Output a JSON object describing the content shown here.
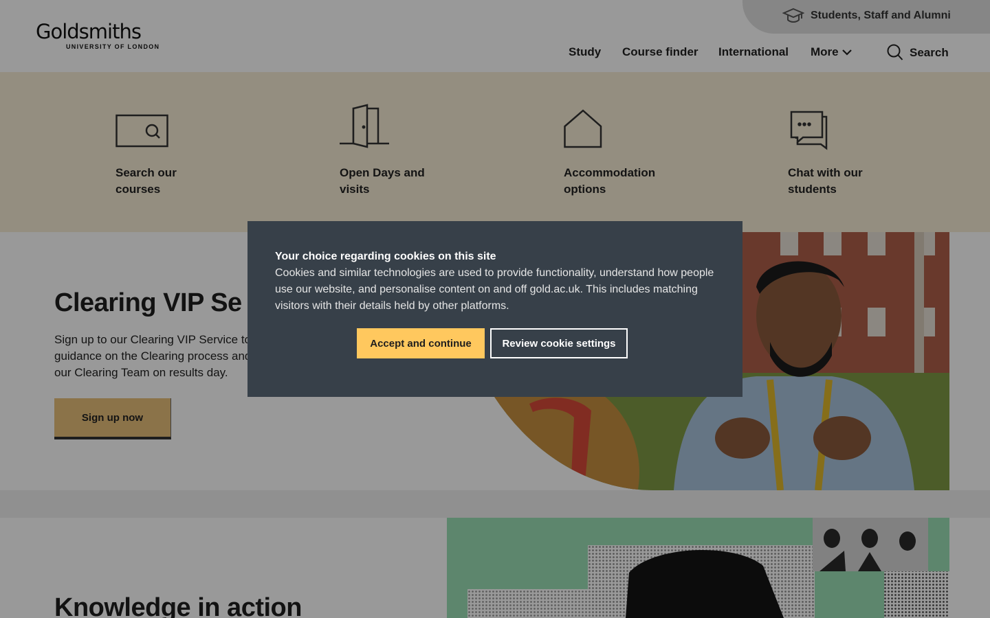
{
  "header": {
    "logo_wordmark": "Goldsmiths",
    "logo_sub": "UNIVERSITY OF LONDON",
    "audience_link": {
      "label": "Students, Staff and Alumni",
      "icon": "mortarboard-icon"
    },
    "nav": [
      {
        "label": "Study"
      },
      {
        "label": "Course finder"
      },
      {
        "label": "International"
      },
      {
        "label": "More",
        "icon": "chevron-down-icon"
      },
      {
        "label": "Search",
        "icon": "search-icon"
      }
    ]
  },
  "quick_links": [
    {
      "label": "Search our courses",
      "icon": "course-search-icon"
    },
    {
      "label": "Open Days and visits",
      "icon": "open-door-icon"
    },
    {
      "label": "Accommodation options",
      "icon": "house-icon"
    },
    {
      "label": "Chat with our students",
      "icon": "chat-bubbles-icon"
    }
  ],
  "clearing": {
    "title": "Clearing VIP Se",
    "text": "Sign up to our Clearing VIP Service to guidance on the Clearing process and our Clearing Team on results day.",
    "button": "Sign up now"
  },
  "knowledge": {
    "title": "Knowledge in action"
  },
  "cookie_banner": {
    "title": "Your choice regarding cookies on this site",
    "body": "Cookies and similar technologies are used to provide functionality, understand how people use our website, and personalise content on and off gold.ac.uk. This includes matching visitors with their details held by other platforms.",
    "accept": "Accept and continue",
    "review": "Review cookie settings"
  },
  "colors": {
    "accent": "#ffc85e",
    "quick_links_bg": "#f7edd6",
    "signup_button": "#e8c07b",
    "cookie_bg": "#374049",
    "knowledge_art_bg": "#9be0b6"
  }
}
